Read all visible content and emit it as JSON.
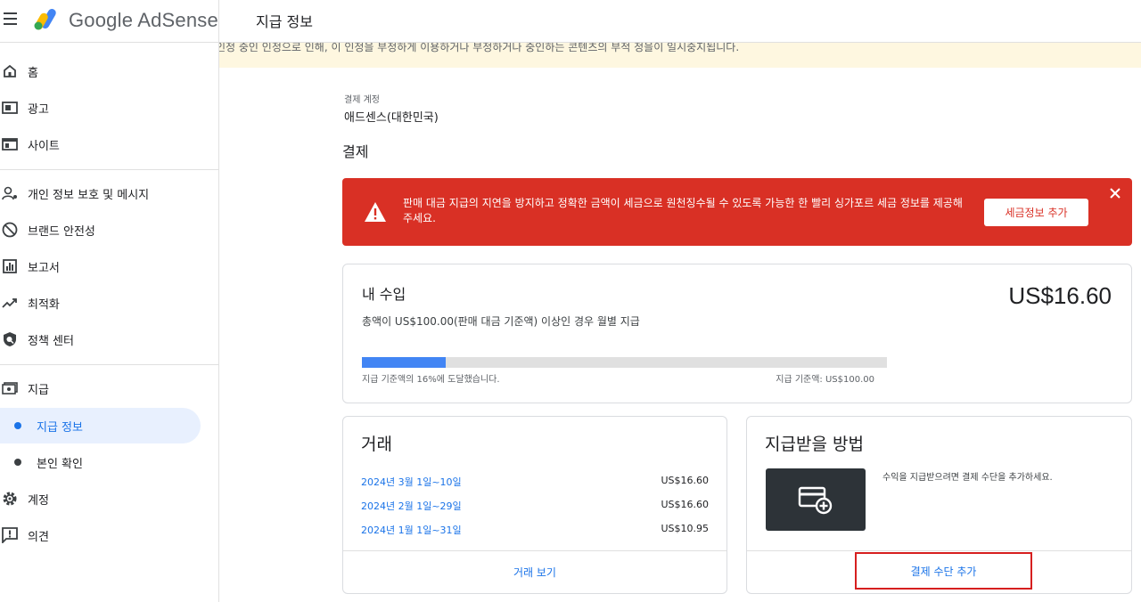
{
  "header": {
    "brand": "Google AdSense",
    "page_title": "지급 정보",
    "warning_strip": "인정 중인 인정으로 인해, 이 인정을 부정하게 이용하거나 부정하거나 중인하는 콘텐츠의 부적 정을이 일시중지됩니다."
  },
  "sidebar": {
    "items": [
      {
        "label": "홈",
        "icon": "home-icon"
      },
      {
        "label": "광고",
        "icon": "ads-icon"
      },
      {
        "label": "사이트",
        "icon": "sites-icon"
      },
      {
        "label": "개인 정보 보호 및 메시지",
        "icon": "privacy-icon"
      },
      {
        "label": "브랜드 안전성",
        "icon": "brand-safety-icon"
      },
      {
        "label": "보고서",
        "icon": "reports-icon"
      },
      {
        "label": "최적화",
        "icon": "optimization-icon"
      },
      {
        "label": "정책 센터",
        "icon": "policy-icon"
      },
      {
        "label": "지급",
        "icon": "payments-icon"
      },
      {
        "label": "지급 정보",
        "icon": "dot"
      },
      {
        "label": "본인 확인",
        "icon": "dot"
      },
      {
        "label": "계정",
        "icon": "gear-icon"
      },
      {
        "label": "의견",
        "icon": "feedback-icon"
      }
    ]
  },
  "account": {
    "label": "결제 계정",
    "value": "애드센스(대한민국)"
  },
  "section_title": "결제",
  "alert": {
    "message": "판매 대금 지급의 지연을 방지하고 정확한 금액이 세금으로 원천징수될 수 있도록 가능한 한 빨리 싱가포르 세금 정보를 제공해 주세요.",
    "button": "세금정보 추가",
    "color": "#d93025"
  },
  "earnings": {
    "title": "내 수입",
    "amount": "US$16.60",
    "description": "총액이 US$100.00(판매 대금 기준액) 이상인 경우 월별 지급",
    "progress_percent": 16,
    "progress_label": "지급 기준액의 16%에 도달했습니다.",
    "threshold_label": "지급 기준액: US$100.00"
  },
  "transactions": {
    "title": "거래",
    "rows": [
      {
        "date": "2024년 3월 1일~10일",
        "amount": "US$16.60"
      },
      {
        "date": "2024년 2월 1일~29일",
        "amount": "US$16.60"
      },
      {
        "date": "2024년 1월 1일~31일",
        "amount": "US$10.95"
      }
    ],
    "view_link": "거래 보기"
  },
  "payment_method": {
    "title": "지급받을 방법",
    "description": "수익을 지급받으려면 결제 수단을 추가하세요.",
    "add_link": "결제 수단 추가"
  }
}
